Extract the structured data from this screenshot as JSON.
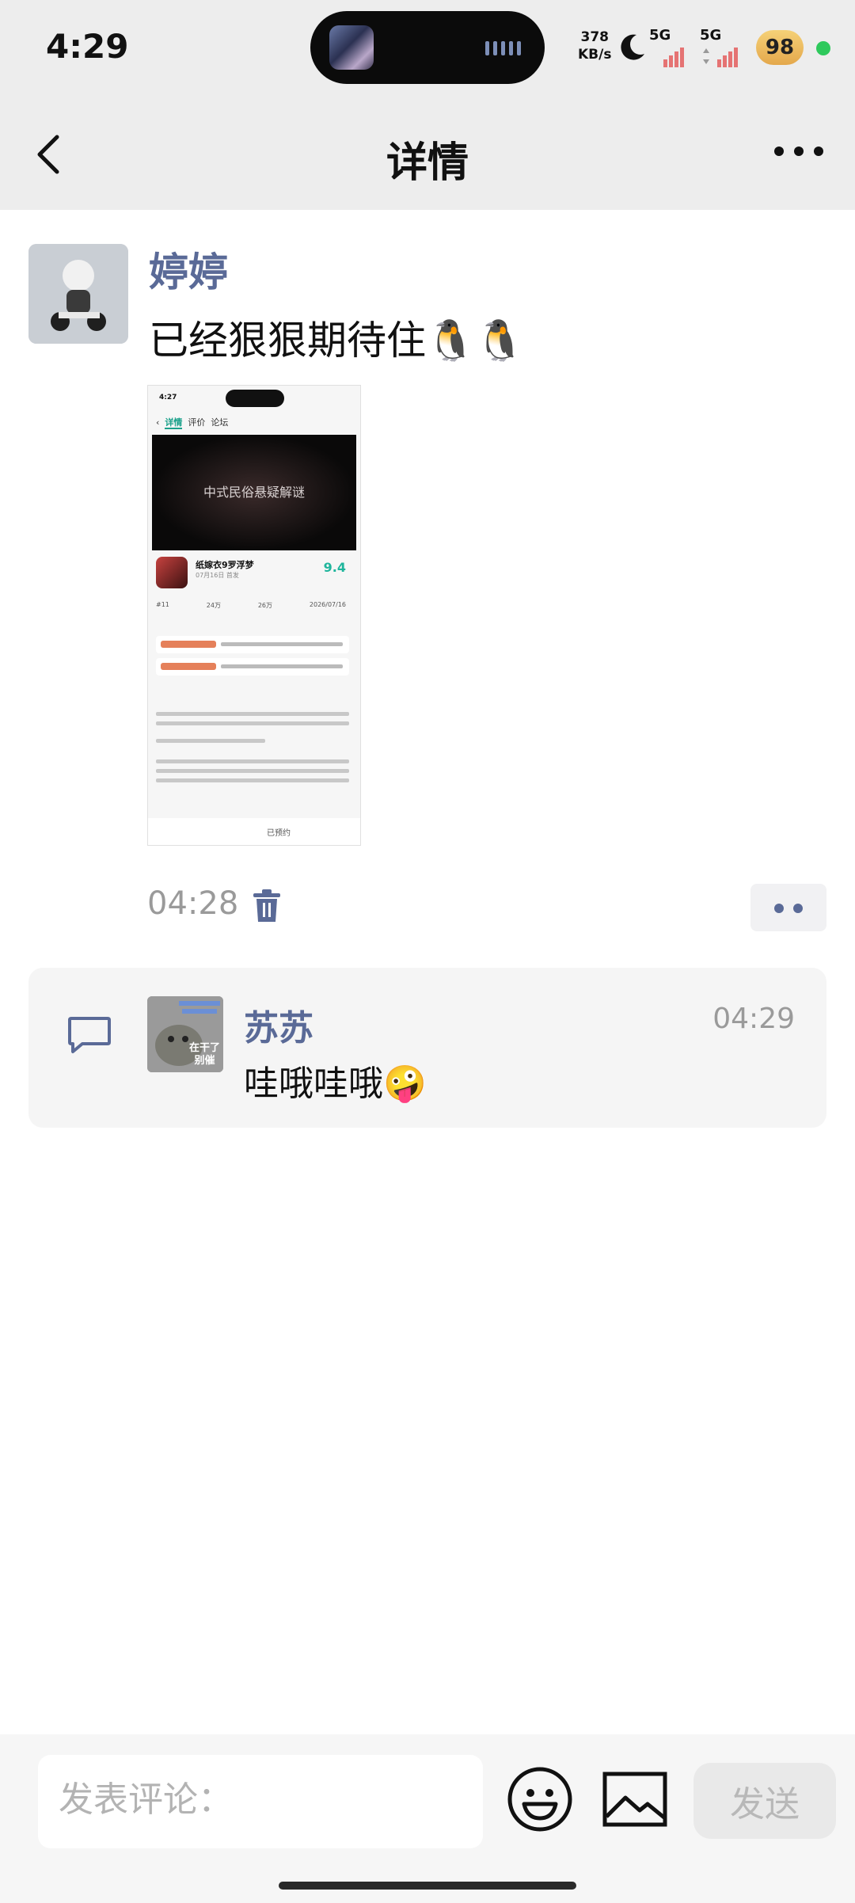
{
  "status_bar": {
    "time": "4:29",
    "net_speed_value": "378",
    "net_speed_unit": "KB/s",
    "signal1": "5G",
    "signal2": "5G",
    "battery": "98"
  },
  "nav": {
    "title": "详情"
  },
  "post": {
    "author": "婷婷",
    "text": "已经狠狠期待住🐧🐧",
    "time": "04:28",
    "image": {
      "status_time": "4:27",
      "tabs": [
        "详情",
        "评价",
        "论坛"
      ],
      "banner_text": "中式民俗悬疑解谜",
      "game_name": "纸嫁衣9罗浮梦",
      "game_sub": "07月16日 首发",
      "score": "9.4",
      "stats": [
        "#11",
        "24万",
        "26万",
        "2026/07/16"
      ],
      "footer_button": "已预约"
    }
  },
  "comment": {
    "author": "苏苏",
    "time": "04:29",
    "text": "哇哦哇哦🤪",
    "avatar_caption_line1": "在干了",
    "avatar_caption_line2": "别催"
  },
  "composer": {
    "placeholder": "发表评论：",
    "send_label": "发送"
  }
}
